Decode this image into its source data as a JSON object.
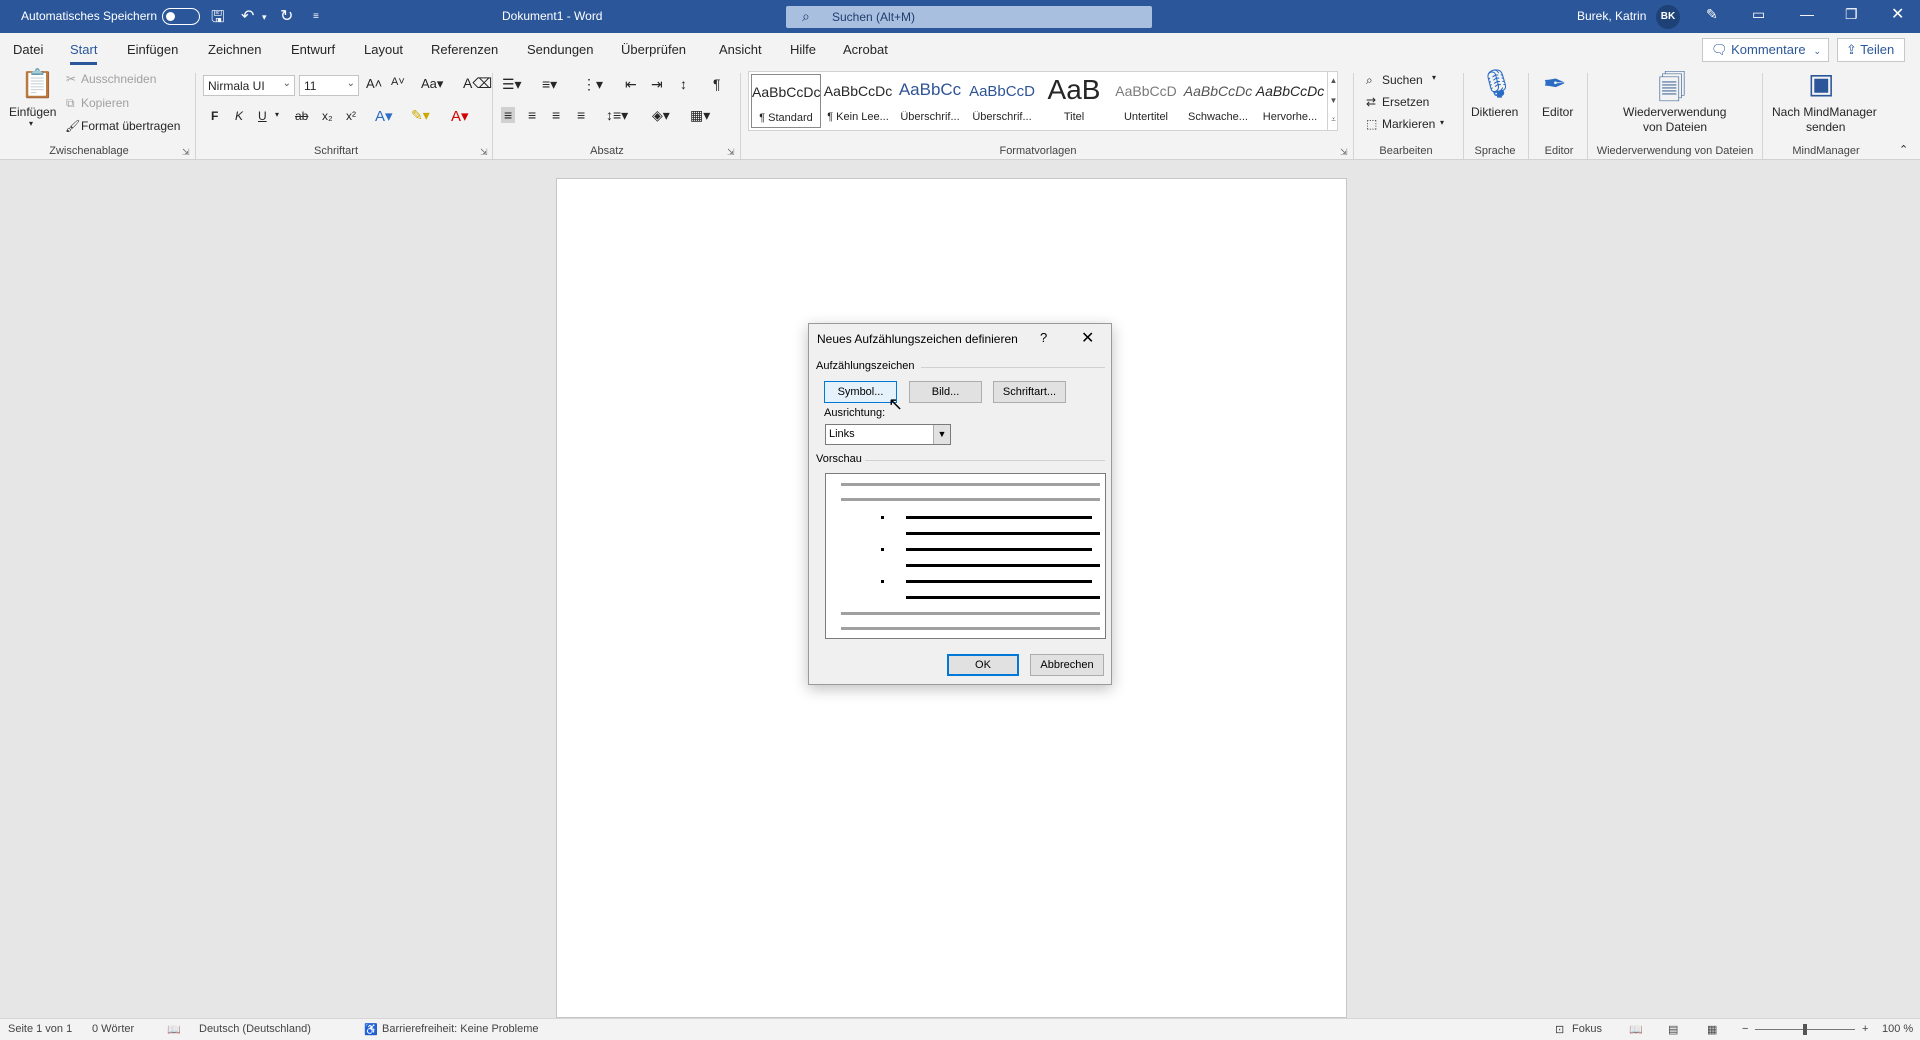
{
  "titlebar": {
    "autosave_label": "Automatisches Speichern",
    "doc_title": "Dokument1  -  Word",
    "search_placeholder": "Suchen (Alt+M)",
    "user_name": "Burek, Katrin",
    "avatar_initials": "BK"
  },
  "tabs": [
    {
      "label": "Datei"
    },
    {
      "label": "Start"
    },
    {
      "label": "Einfügen"
    },
    {
      "label": "Zeichnen"
    },
    {
      "label": "Entwurf"
    },
    {
      "label": "Layout"
    },
    {
      "label": "Referenzen"
    },
    {
      "label": "Sendungen"
    },
    {
      "label": "Überprüfen"
    },
    {
      "label": "Ansicht"
    },
    {
      "label": "Hilfe"
    },
    {
      "label": "Acrobat"
    }
  ],
  "tab_actions": {
    "comments": "Kommentare",
    "share": "Teilen"
  },
  "ribbon": {
    "clipboard": {
      "paste": "Einfügen",
      "cut": "Ausschneiden",
      "copy": "Kopieren",
      "format_painter": "Format übertragen",
      "group": "Zwischenablage"
    },
    "font": {
      "font_name": "Nirmala UI",
      "font_size": "11",
      "group": "Schriftart"
    },
    "paragraph": {
      "group": "Absatz"
    },
    "styles": {
      "items": [
        {
          "preview": "AaBbCcDc",
          "name": "¶ Standard"
        },
        {
          "preview": "AaBbCcDc",
          "name": "¶ Kein Lee..."
        },
        {
          "preview": "AaBbCc",
          "name": "Überschrif..."
        },
        {
          "preview": "AaBbCcD",
          "name": "Überschrif..."
        },
        {
          "preview": "AaB",
          "name": "Titel"
        },
        {
          "preview": "AaBbCcD",
          "name": "Untertitel"
        },
        {
          "preview": "AaBbCcDc",
          "name": "Schwache..."
        },
        {
          "preview": "AaBbCcDc",
          "name": "Hervorhe..."
        }
      ],
      "group": "Formatvorlagen"
    },
    "editing": {
      "find": "Suchen",
      "replace": "Ersetzen",
      "select": "Markieren",
      "group": "Bearbeiten"
    },
    "voice": {
      "dictate": "Diktieren",
      "group": "Sprache"
    },
    "editor": {
      "editor": "Editor",
      "group": "Editor"
    },
    "reuse": {
      "label_line1": "Wiederverwendung",
      "label_line2": "von Dateien",
      "group": "Wiederverwendung von Dateien"
    },
    "mindmanager": {
      "label_line1": "Nach MindManager",
      "label_line2": "senden",
      "group": "MindManager"
    }
  },
  "dialog": {
    "title": "Neues Aufzählungszeichen definieren",
    "help": "?",
    "section_bullets": "Aufzählungszeichen",
    "symbol_button": "Symbol...",
    "picture_button": "Bild...",
    "font_button": "Schriftart...",
    "alignment_label": "Ausrichtung:",
    "alignment_value": "Links",
    "section_preview": "Vorschau",
    "ok_button": "OK",
    "cancel_button": "Abbrechen"
  },
  "statusbar": {
    "page": "Seite 1 von 1",
    "words": "0 Wörter",
    "language": "Deutsch (Deutschland)",
    "accessibility": "Barrierefreiheit: Keine Probleme",
    "focus": "Fokus",
    "zoom": "100 %"
  },
  "colors": {
    "accent": "#2b579a",
    "ribbon_bg": "#f3f3f3",
    "dialog_bg": "#f0f0f0"
  }
}
